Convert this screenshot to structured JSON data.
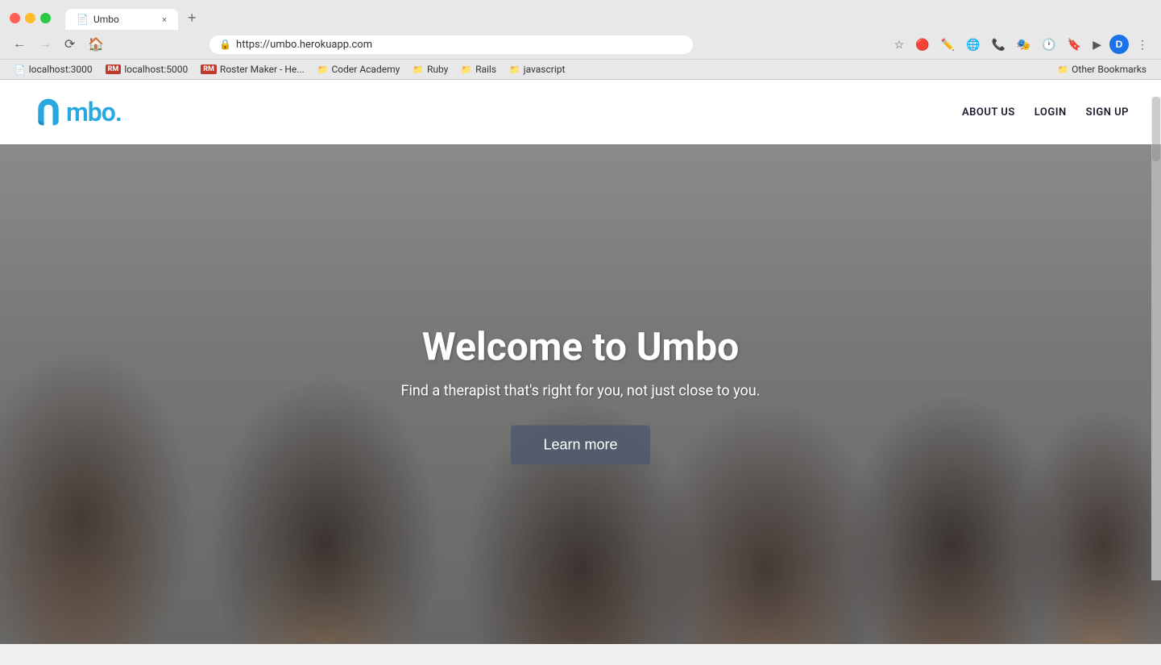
{
  "browser": {
    "tab_title": "Umbo",
    "tab_icon": "📄",
    "url": "https://umbo.herokuapp.com",
    "new_tab_label": "+",
    "close_tab": "×"
  },
  "bookmarks": [
    {
      "id": "localhost3000",
      "label": "localhost:3000",
      "type": "page",
      "icon": "📄"
    },
    {
      "id": "localhost5000",
      "label": "localhost:5000",
      "type": "rm",
      "icon": "RM"
    },
    {
      "id": "roster-maker",
      "label": "Roster Maker - He...",
      "type": "rm",
      "icon": "RM"
    },
    {
      "id": "coder-academy",
      "label": "Coder Academy",
      "type": "folder",
      "icon": "📁"
    },
    {
      "id": "ruby",
      "label": "Ruby",
      "type": "folder",
      "icon": "📁"
    },
    {
      "id": "rails",
      "label": "Rails",
      "type": "folder",
      "icon": "📁"
    },
    {
      "id": "javascript",
      "label": "javascript",
      "type": "folder",
      "icon": "📁"
    },
    {
      "id": "other-bookmarks",
      "label": "Other Bookmarks",
      "type": "folder",
      "icon": "📁"
    }
  ],
  "nav": {
    "logo_text": "mbo.",
    "logo_icon_letter": "U",
    "links": [
      {
        "id": "about-us",
        "label": "ABOUT US"
      },
      {
        "id": "login",
        "label": "LOGIN"
      },
      {
        "id": "sign-up",
        "label": "SIGN UP"
      }
    ]
  },
  "hero": {
    "title": "Welcome to Umbo",
    "subtitle": "Find a therapist that's right for you, not just close to you.",
    "cta_label": "Learn more"
  }
}
